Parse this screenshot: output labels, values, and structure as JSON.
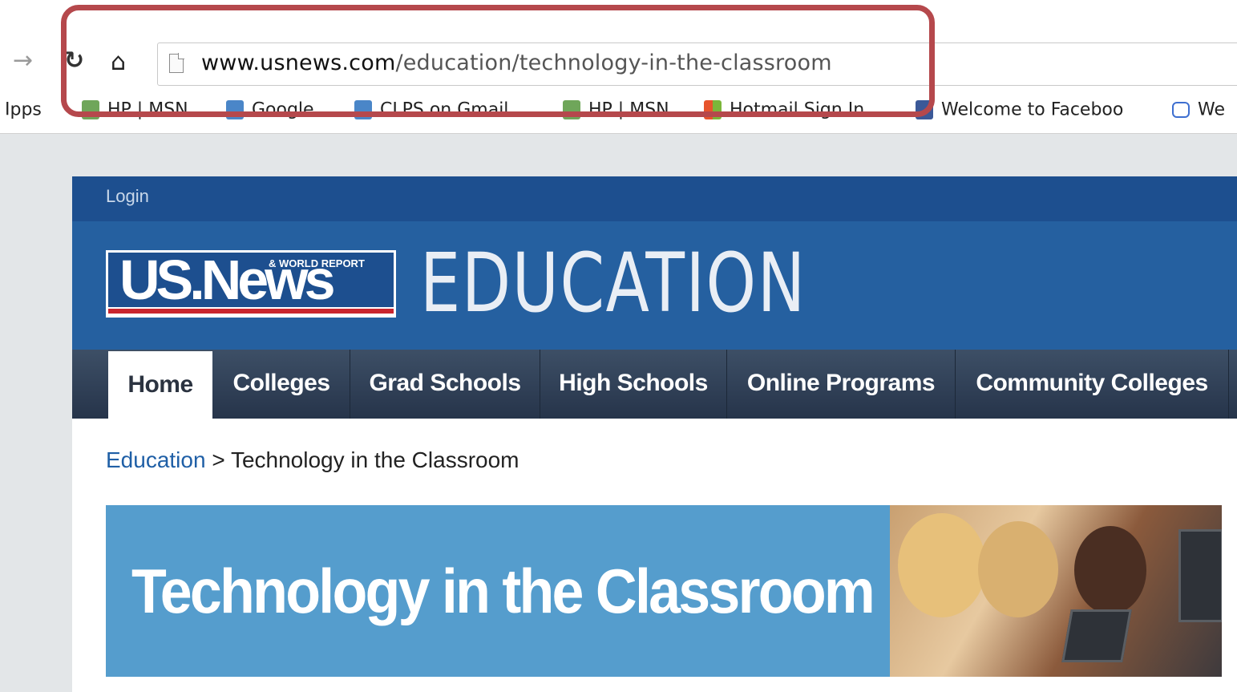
{
  "browser": {
    "url_domain": "www.usnews.com",
    "url_path": "/education/technology-in-the-classroom",
    "bookmarks": [
      {
        "label": "Ιpps",
        "color": "transparent"
      },
      {
        "label": "HP | MSN",
        "color": "#6fa65a"
      },
      {
        "label": "Google",
        "color": "#4a86c8"
      },
      {
        "label": "CLPS on Gmail",
        "color": "#4a86c8"
      },
      {
        "label": "HP | MSN",
        "color": "#6fa65a"
      },
      {
        "label": "Hotmail Sign In",
        "color": "#e8a23a"
      },
      {
        "label": "Welcome to Faceboo",
        "color": "#3b5998"
      },
      {
        "label": "We",
        "color": "#3e6fd0"
      }
    ]
  },
  "site": {
    "login": "Login",
    "logo_text": "US.News",
    "logo_sub": "& WORLD REPORT",
    "section_title": "EDUCATION",
    "nav_tabs": [
      "Home",
      "Colleges",
      "Grad Schools",
      "High Schools",
      "Online Programs",
      "Community Colleges"
    ],
    "active_tab": "Home",
    "breadcrumb": {
      "link": "Education",
      "separator": ">",
      "current": "Technology in the Classroom"
    },
    "hero_title": "Technology in the Classroom"
  },
  "colors": {
    "highlight_border": "#b5484c",
    "masthead_blue": "#2560a0",
    "hero_blue": "#559dcd"
  }
}
